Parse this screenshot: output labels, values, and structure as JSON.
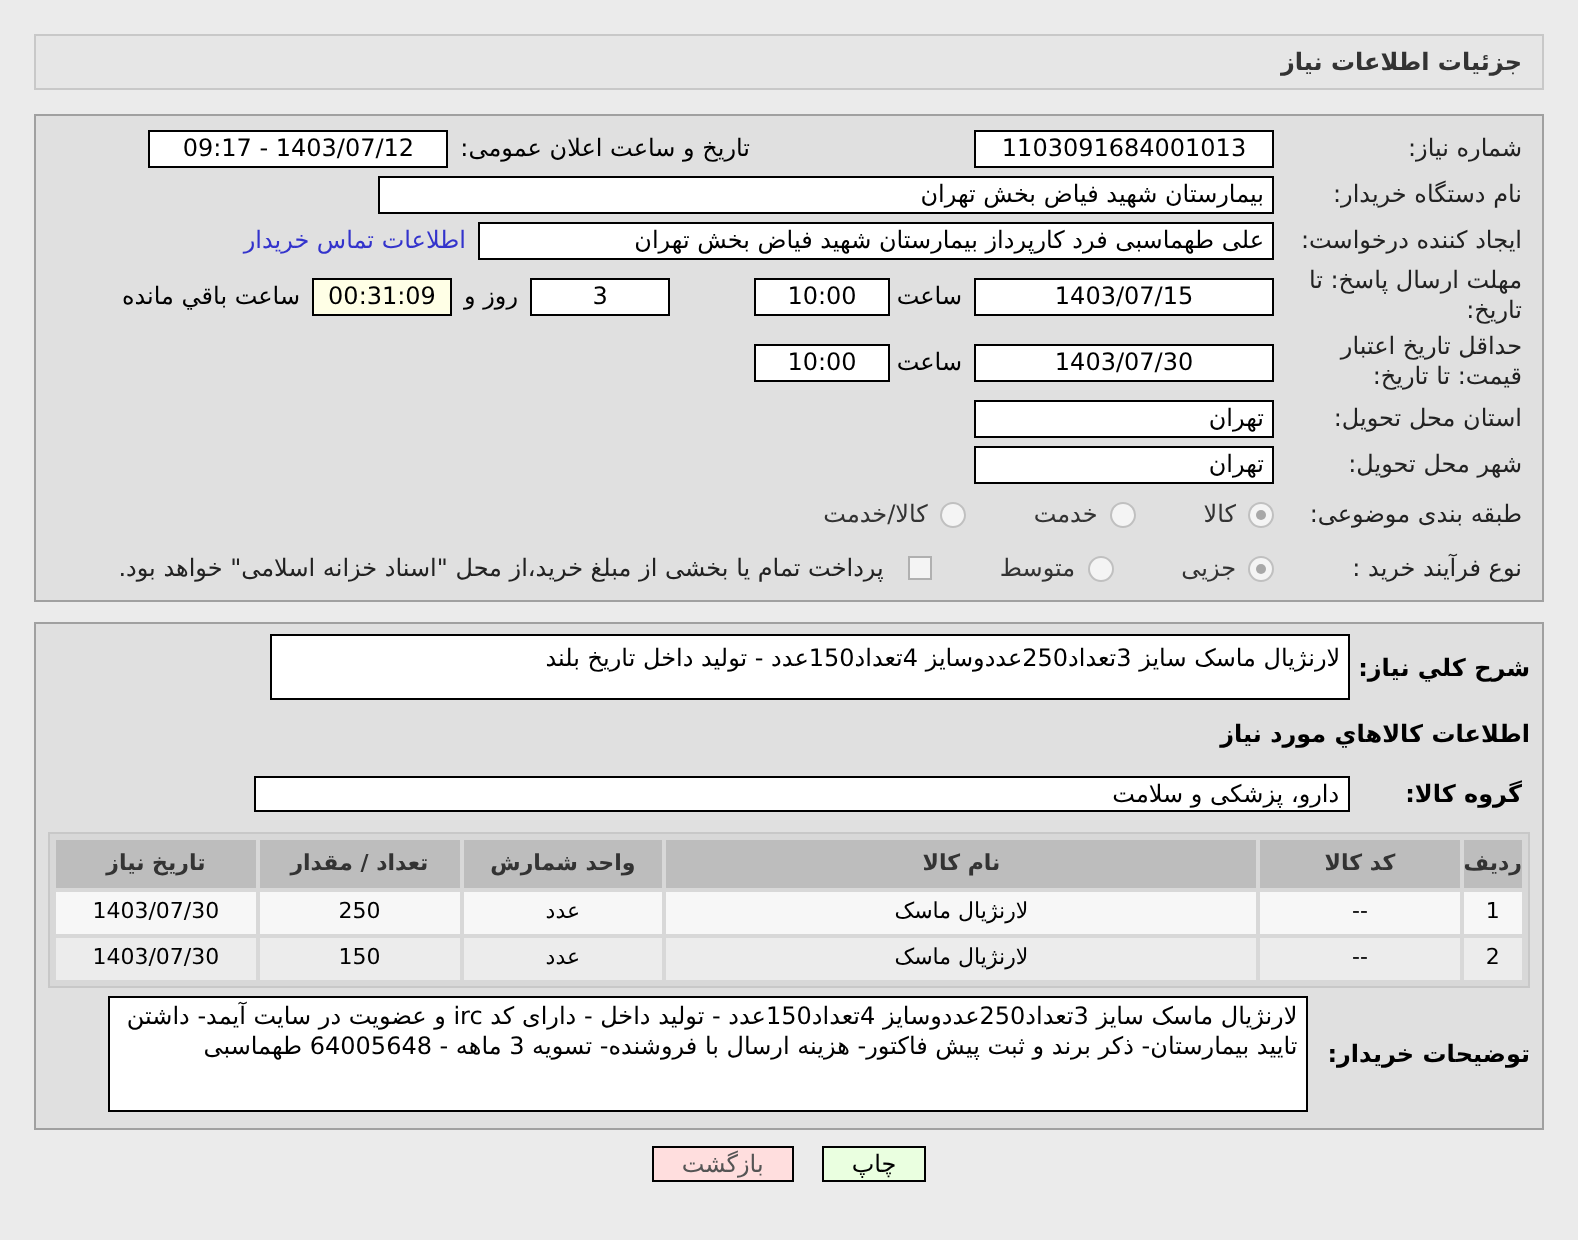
{
  "header": {
    "title": "جزئیات اطلاعات نیاز"
  },
  "details": {
    "need_number": {
      "label": "شماره نیاز:",
      "value": "1103091684001013"
    },
    "announce": {
      "label": "تاریخ و ساعت اعلان عمومی:",
      "value": "1403/07/12 - 09:17"
    },
    "buyer": {
      "label": "نام دستگاه خریدار:",
      "value": "بیمارستان شهید فیاض بخش تهران"
    },
    "creator": {
      "label": "ایجاد کننده درخواست:",
      "value": "علی طهماسبی فرد کارپرداز بیمارستان شهید فیاض بخش تهران",
      "link": "اطلاعات تماس خریدار"
    },
    "deadline": {
      "label": "مهلت ارسال پاسخ: تا تاریخ:",
      "date": "1403/07/15",
      "time_label": "ساعت",
      "time": "10:00",
      "days": "3",
      "days_label": "روز و",
      "remaining": "00:31:09",
      "remaining_label": "ساعت باقي مانده"
    },
    "validity": {
      "label": "حداقل تاریخ اعتبار قیمت: تا تاریخ:",
      "date": "1403/07/30",
      "time_label": "ساعت",
      "time": "10:00"
    },
    "province": {
      "label": "استان محل تحویل:",
      "value": "تهران"
    },
    "city": {
      "label": "شهر محل تحویل:",
      "value": "تهران"
    },
    "category": {
      "label": "طبقه بندی موضوعی:",
      "options": [
        {
          "label": "کالا",
          "selected": true
        },
        {
          "label": "خدمت",
          "selected": false
        },
        {
          "label": "کالا/خدمت",
          "selected": false
        }
      ]
    },
    "process": {
      "label": "نوع فرآیند خرید :",
      "options": [
        {
          "label": "جزیی",
          "selected": true
        },
        {
          "label": "متوسط",
          "selected": false
        }
      ],
      "payment": {
        "label": "پرداخت تمام یا بخشی از مبلغ خرید،از محل \"اسناد خزانه اسلامی\" خواهد بود.",
        "checked": false
      }
    }
  },
  "goods": {
    "summary": {
      "label": "شرح کلي نیاز:",
      "value": "لارنژیال ماسک سایز 3تعداد250عددوسایز 4تعداد150عدد - تولید داخل تاریخ بلند"
    },
    "section_title": "اطلاعات کالاهاي مورد نیاز",
    "group": {
      "label": "گروه کالا:",
      "value": "دارو، پزشکی و سلامت"
    },
    "table": {
      "columns": [
        "ردیف",
        "کد کالا",
        "نام کالا",
        "واحد شمارش",
        "تعداد / مقدار",
        "تاریخ نیاز"
      ],
      "rows": [
        [
          "1",
          "--",
          "لارنژیال ماسک",
          "عدد",
          "250",
          "1403/07/30"
        ],
        [
          "2",
          "--",
          "لارنژیال ماسک",
          "عدد",
          "150",
          "1403/07/30"
        ]
      ]
    },
    "notes": {
      "label": "توضیحات خریدار:",
      "value": "لارنژیال ماسک سایز 3تعداد250عددوسایز 4تعداد150عدد - تولید داخل  - دارای کد irc و عضویت در سایت آیمد- داشتن تایید بیمارستان- ذکر برند و ثبت پیش فاکتور- هزینه ارسال با فروشنده- تسویه 3 ماهه - 64005648 طهماسبی"
    }
  },
  "buttons": [
    {
      "label": "چاپ",
      "kind": "print"
    },
    {
      "label": "بازگشت",
      "kind": "back"
    }
  ]
}
